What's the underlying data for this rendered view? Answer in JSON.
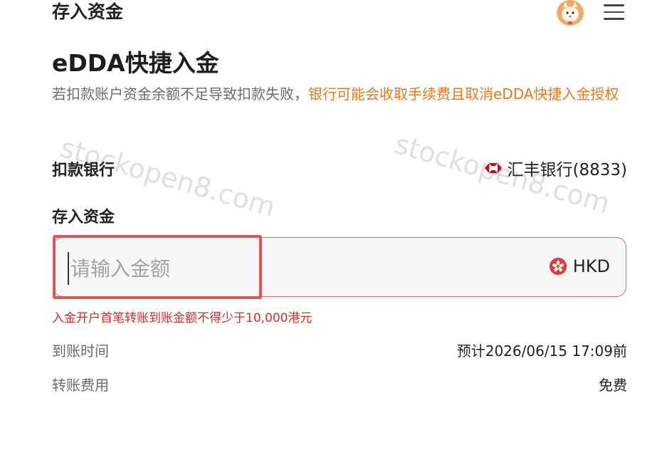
{
  "header": {
    "title": "存入资金",
    "avatar_icon": "avatar-icon",
    "menu_icon": "hamburger-menu-icon"
  },
  "main": {
    "title": "eDDA快捷入金",
    "notice_normal": "若扣款账户资金余额不足导致扣款失败，",
    "notice_warning": "银行可能会收取手续费且取消eDDA快捷入金授权",
    "watermark": "stockopen8.com"
  },
  "bank": {
    "label": "扣款银行",
    "value": "汇丰银行(8833)",
    "logo_icon": "hsbc-logo-icon"
  },
  "deposit": {
    "label": "存入资金",
    "placeholder": "请输入金额",
    "currency": "HKD",
    "currency_icon": "hong-kong-flag-icon",
    "min_warning": "入金开户首笔转账到账金额不得少于10,000港元"
  },
  "info": {
    "arrival_label": "到账时间",
    "arrival_value": "预计2026/06/15 17:09前",
    "fee_label": "转账费用",
    "fee_value": "免费"
  },
  "colors": {
    "warning_orange": "#e67a1c",
    "error_red": "#d22d2d",
    "highlight_red": "#e05454"
  }
}
